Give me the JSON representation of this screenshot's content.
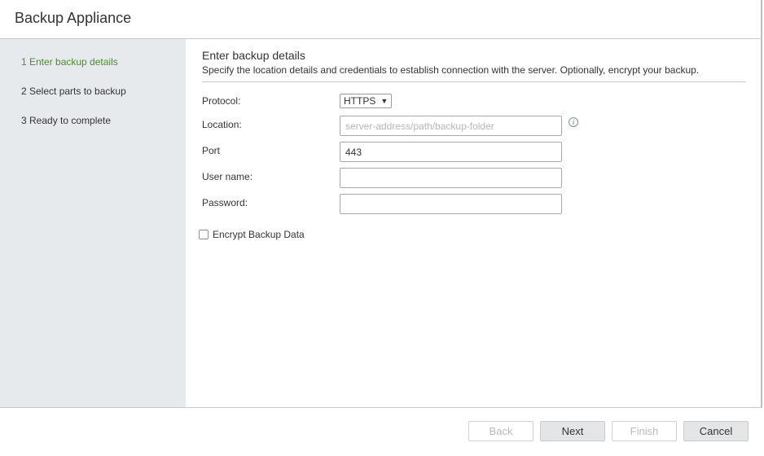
{
  "dialog": {
    "title": "Backup Appliance"
  },
  "steps": [
    {
      "label": "1 Enter backup details",
      "active": true
    },
    {
      "label": "2 Select parts to backup",
      "active": false
    },
    {
      "label": "3 Ready to complete",
      "active": false
    }
  ],
  "page": {
    "title": "Enter backup details",
    "description": "Specify the location details and credentials to establish connection with the server. Optionally, encrypt your backup."
  },
  "form": {
    "protocol": {
      "label": "Protocol:",
      "value": "HTTPS",
      "arrow": "▼"
    },
    "location": {
      "label": "Location:",
      "value": "",
      "placeholder": "server-address/path/backup-folder",
      "info_icon": "info-icon"
    },
    "port": {
      "label": "Port",
      "value": "443"
    },
    "username": {
      "label": "User name:",
      "value": ""
    },
    "password": {
      "label": "Password:",
      "value": ""
    },
    "encrypt": {
      "label": "Encrypt Backup Data",
      "checked": false
    }
  },
  "buttons": {
    "back": "Back",
    "next": "Next",
    "finish": "Finish",
    "cancel": "Cancel"
  },
  "colors": {
    "active_step": "#4c8c2b",
    "sidebar_bg": "#e7eaed"
  }
}
